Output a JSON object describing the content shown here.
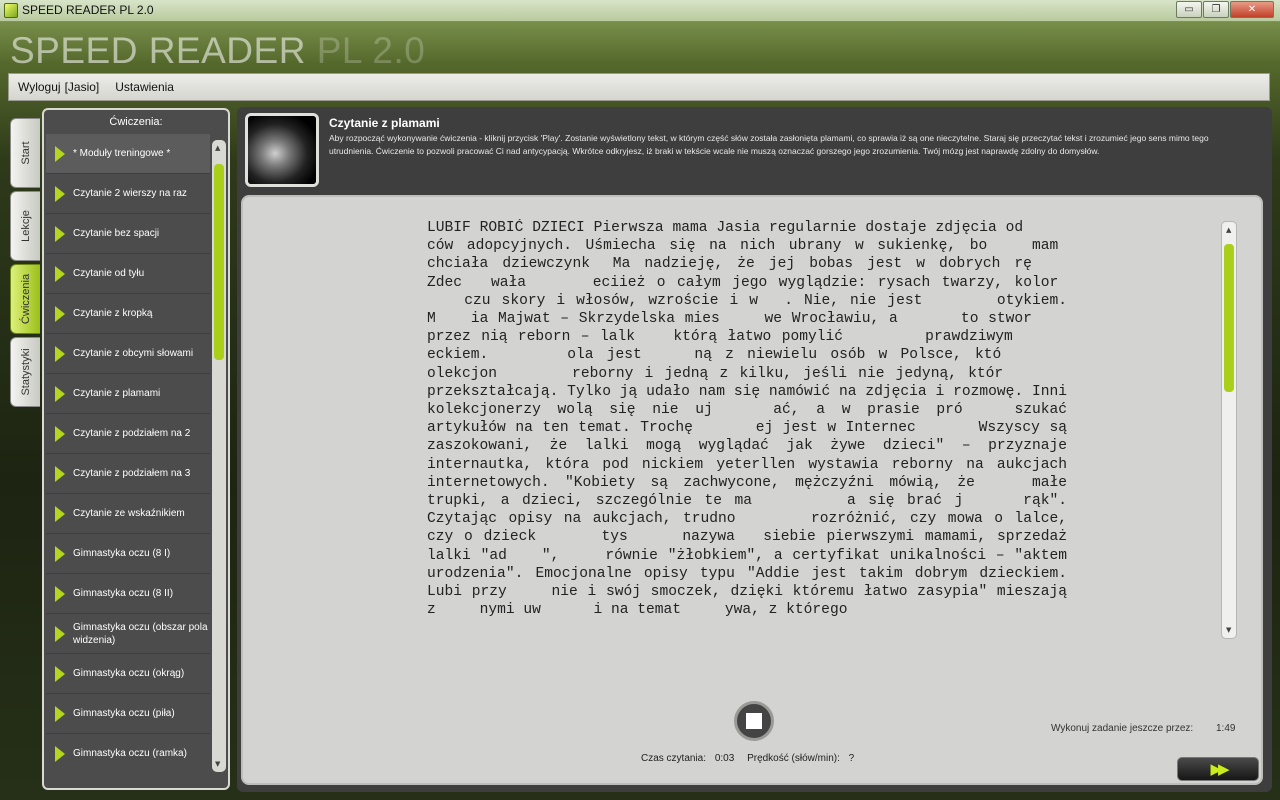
{
  "window": {
    "title": "SPEED READER PL 2.0",
    "controls": {
      "minimize": "▭",
      "maximize": "❐",
      "close": "✕"
    }
  },
  "brand": {
    "main": "SPEED READER ",
    "version": "PL 2.0"
  },
  "menu": {
    "logout": "Wyloguj",
    "user": "[Jasio]",
    "settings": "Ustawienia"
  },
  "tabs": [
    {
      "label": "Start",
      "active": false
    },
    {
      "label": "Lekcje",
      "active": false
    },
    {
      "label": "Ćwiczenia",
      "active": true
    },
    {
      "label": "Statystyki",
      "active": false
    }
  ],
  "sidebar": {
    "header": "Ćwiczenia:",
    "items": [
      "* Moduły treningowe *",
      "Czytanie 2 wierszy na raz",
      "Czytanie bez spacji",
      "Czytanie od tyłu",
      "Czytanie z kropką",
      "Czytanie z obcymi słowami",
      "Czytanie z plamami",
      "Czytanie z podziałem na 2",
      "Czytanie z podziałem na 3",
      "Czytanie ze wskaźnikiem",
      "Gimnastyka oczu (8 I)",
      "Gimnastyka oczu (8 II)",
      "Gimnastyka oczu (obszar pola widzenia)",
      "Gimnastyka oczu (okrąg)",
      "Gimnastyka oczu (piła)",
      "Gimnastyka oczu (ramka)"
    ],
    "scroll_up": "▲",
    "scroll_down": "▼"
  },
  "exercise": {
    "title": "Czytanie z plamami",
    "description": "Aby rozpocząć wykonywanie ćwiczenia - kliknij przycisk 'Play'. Zostanie wyświetlony tekst, w którym część słów została zasłonięta plamami, co sprawia iż są one nieczytelne. Staraj się przeczytać tekst i zrozumieć jego sens mimo tego utrudnienia. Ćwiczenie to pozwoli pracować Ci nad antycypacją. Wkrótce odkryjesz, iż braki w tekście wcale nie muszą oznaczać gorszego jego zrozumienia. Twój mózg jest naprawdę zdolny do domysłów."
  },
  "reading_text": "LUBIF ROBIĆ DZIECI Pierwsza mama Jasia regularnie dostaje zdjęcia od ____ ców adopcyjnych. Uśmiecha się na nich ubrany w sukienkę, bo __ mam_ chciała dziewczynk_ Ma nadzieję, że jej bobas jest w dobrych rę____ Zdec__ wała _____ eciież o całym jego wyglądzie: rysach twarzy, kolor_ ___ czu skory i włosów, wzroście i w___. Nie, nie jest ______ otykiem. M____ia Majwat – Skrzydelska mies____ we Wrocławiu, a _____ to stwor____ przez nią reborn – lalk_ _ którą łatwo pomylić _______ prawdziwym _____ eckiem. ______ ola jest ___ ną z niewielu osób w Polsce, któ_ _____ olekcjon ______ reborny i jedną z kilku, jeśli nie jedyną, któr__ ____ przekształcają. Tylko ją udało nam się namówić na zdjęcia i rozmowę. Inni kolekcjonerzy wolą się nie uj_____ ać, a w prasie pró____ szukać artykułów na ten temat. Trochę _____ ej jest w Internec__ ___ Wszyscy są zaszokowani, że lalki mogą wyglądać jak żywe dzieci\" – przyznaje internautka, która pod nickiem yeterllen wystawia reborny na aukcjach internetowych. \"Kobiety są zachwycone, mężczyźni mówią, że ___ małe trupki, a dzieci, szczególnie te ma____ ____ a się brać j_ ___ rąk\". Czytając opisy na aukcjach, trudno ______ rozróżnić, czy mowa o lalce, czy o dzieck_ ____ tys_____ nazywa__ siebie pierwszymi mamami, sprzedaż lalki \"ad____\", ___ równie \"żłobkiem\", a certyfikat unikalności – \"aktem urodzenia\". Emocjonalne opisy typu \"Addie jest takim dobrym dzieckiem. Lubi przy____ nie i swój smoczek, dzięki któremu łatwo zasypia\" mieszają z ___ nymi uw_____ i na temat ___ ywa, z którego",
  "controls": {
    "stop_label": "Stop",
    "reading_time_label": "Czas czytania:",
    "reading_time_value": "0:03",
    "speed_label": "Prędkość (słów/min):",
    "speed_value": "?",
    "remaining_label": "Wykonuj zadanie jeszcze przez:",
    "remaining_value": "1:49",
    "next_label": "▶▶"
  },
  "colors": {
    "accent": "#a9cf1b",
    "panel_dark": "#3e3e3e",
    "text_area": "#d3d3d1"
  }
}
